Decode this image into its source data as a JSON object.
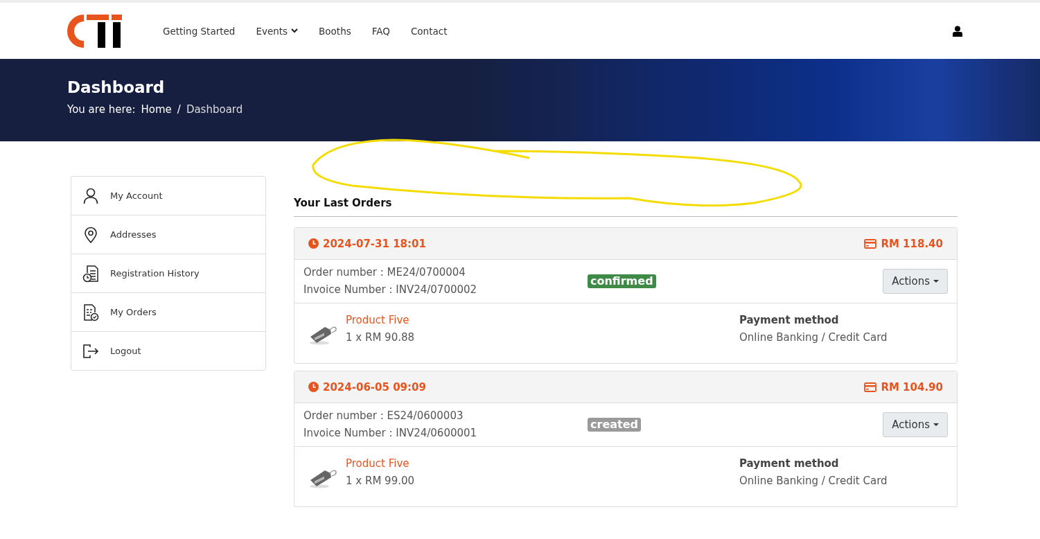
{
  "nav": {
    "items": [
      {
        "label": "Getting Started",
        "dropdown": false
      },
      {
        "label": "Events",
        "dropdown": true
      },
      {
        "label": "Booths",
        "dropdown": false
      },
      {
        "label": "FAQ",
        "dropdown": false
      },
      {
        "label": "Contact",
        "dropdown": false
      }
    ]
  },
  "banner": {
    "title": "Dashboard",
    "breadcrumb_prefix": "You are here:",
    "breadcrumbs": [
      {
        "label": "Home"
      },
      {
        "separator": "/",
        "label": "Dashboard"
      }
    ]
  },
  "sidebar": {
    "items": [
      {
        "label": "My Account",
        "kind": "person"
      },
      {
        "label": "Addresses",
        "kind": "pin"
      },
      {
        "label": "Registration History",
        "kind": "history"
      },
      {
        "label": "My Orders",
        "kind": "orders"
      },
      {
        "label": "Logout",
        "kind": "logout"
      }
    ]
  },
  "orders_section": {
    "title": "Your Last Orders",
    "orders": [
      {
        "datetime": "2024-07-31 18:01",
        "total": "RM 118.40",
        "order_number": "Order number : ME24/0700004",
        "invoice_number": "Invoice Number : INV24/0700002",
        "status": {
          "label": "confirmed",
          "color": "#3e8a46"
        },
        "actions": "Actions",
        "product": "Product Five",
        "quantity_price": "1 x RM 90.88",
        "payment_label": "Payment method",
        "payment_method": "Online Banking / Credit Card"
      },
      {
        "datetime": "2024-06-05 09:09",
        "total": "RM 104.90",
        "order_number": "Order number : ES24/0600003",
        "invoice_number": "Invoice Number : INV24/0600001",
        "status": {
          "label": "created",
          "color": "#9a9a9a"
        },
        "actions": "Actions",
        "product": "Product Five",
        "quantity_price": "1 x RM 99.00",
        "payment_label": "Payment method",
        "payment_method": "Online Banking / Credit Card"
      }
    ]
  }
}
